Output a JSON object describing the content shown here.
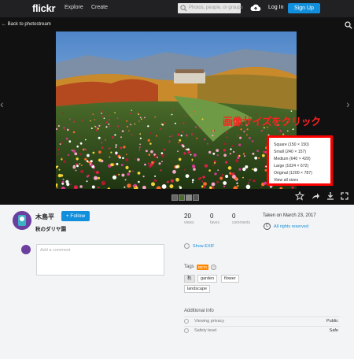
{
  "nav": {
    "logo": "flickr",
    "explore": "Explore",
    "create": "Create",
    "search_placeholder": "Photos, people, or groups",
    "login": "Log In",
    "signup": "Sign Up"
  },
  "viewer": {
    "back": "Back to photostream",
    "callout": "画像サイズをクリック",
    "sizes": [
      "Square (150 × 150)",
      "Small (240 × 157)",
      "Medium (640 × 420)",
      "Large (1024 × 672)",
      "Original (1200 × 787)",
      "View all sizes"
    ]
  },
  "owner": {
    "name": "木島平",
    "follow": "+ Follow",
    "photo_title": "秋のダリヤ園"
  },
  "comment": {
    "placeholder": "Add a comment"
  },
  "stats": [
    {
      "value": "20",
      "label": "views"
    },
    {
      "value": "0",
      "label": "faves"
    },
    {
      "value": "0",
      "label": "comments"
    }
  ],
  "taken": "Taken on March 23, 2017",
  "rights": "All rights reserved",
  "cc_symbol": "C",
  "show_exif": "Show EXIF",
  "tags": {
    "label": "Tags",
    "beta": "BETA",
    "help": "?",
    "items": [
      "秋",
      "garden",
      "flower",
      "landscape"
    ]
  },
  "additional": {
    "title": "Additional info",
    "rows": [
      {
        "label": "Viewing privacy",
        "value": "Public"
      },
      {
        "label": "Safety level",
        "value": "Safe"
      }
    ]
  },
  "colors": {
    "accent": "#128fdc",
    "nav_bg": "#212124",
    "callout": "#ff0000"
  }
}
